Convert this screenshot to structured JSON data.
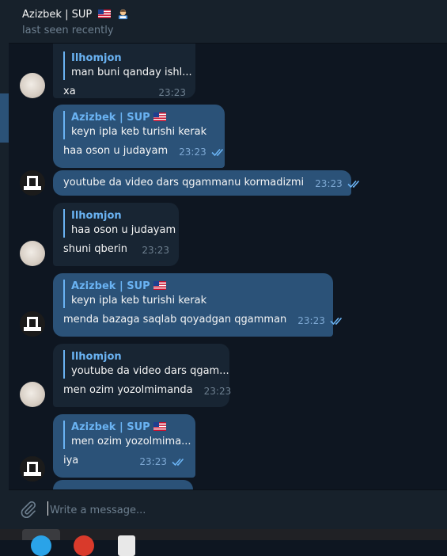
{
  "header": {
    "title": "Azizbek | SUP",
    "status": "last seen recently"
  },
  "messages": [
    {
      "direction": "in",
      "reply_name": "Ilhomjon",
      "reply_text": "man buni qanday ishl...",
      "text": "xa",
      "time": "23:23"
    },
    {
      "direction": "out",
      "reply_name": "Azizbek | SUP",
      "reply_text": "keyn ipla keb turishi kerak",
      "text": "haa oson u judayam",
      "time": "23:23"
    },
    {
      "direction": "out",
      "text": "youtube da video dars qgammanu kormadizmi",
      "time": "23:23"
    },
    {
      "direction": "in",
      "reply_name": "Ilhomjon",
      "reply_text": "haa oson u judayam",
      "text": "shuni qberin",
      "time": "23:23"
    },
    {
      "direction": "out",
      "reply_name": "Azizbek | SUP",
      "reply_text": "keyn ipla keb turishi kerak",
      "text": "menda bazaga saqlab qoyadgan qgamman",
      "time": "23:23"
    },
    {
      "direction": "in",
      "reply_name": "Ilhomjon",
      "reply_text": "youtube da video dars qgam...",
      "text": "men ozim yozolmimanda",
      "time": "23:23"
    },
    {
      "direction": "out",
      "reply_name": "Azizbek | SUP",
      "reply_text": "men ozim yozolmima...",
      "text": "iya",
      "time": "23:23"
    }
  ],
  "composer": {
    "placeholder": "Write a message..."
  },
  "colors": {
    "background": "#0e1621",
    "panel": "#17212b",
    "incoming": "#182533",
    "outgoing": "#2b5278",
    "accent": "#6ab3f3"
  },
  "icons": {
    "attach": "paperclip-icon",
    "read": "double-check-icon",
    "flag": "us-flag-icon",
    "emoji": "teacher-emoji-icon"
  }
}
